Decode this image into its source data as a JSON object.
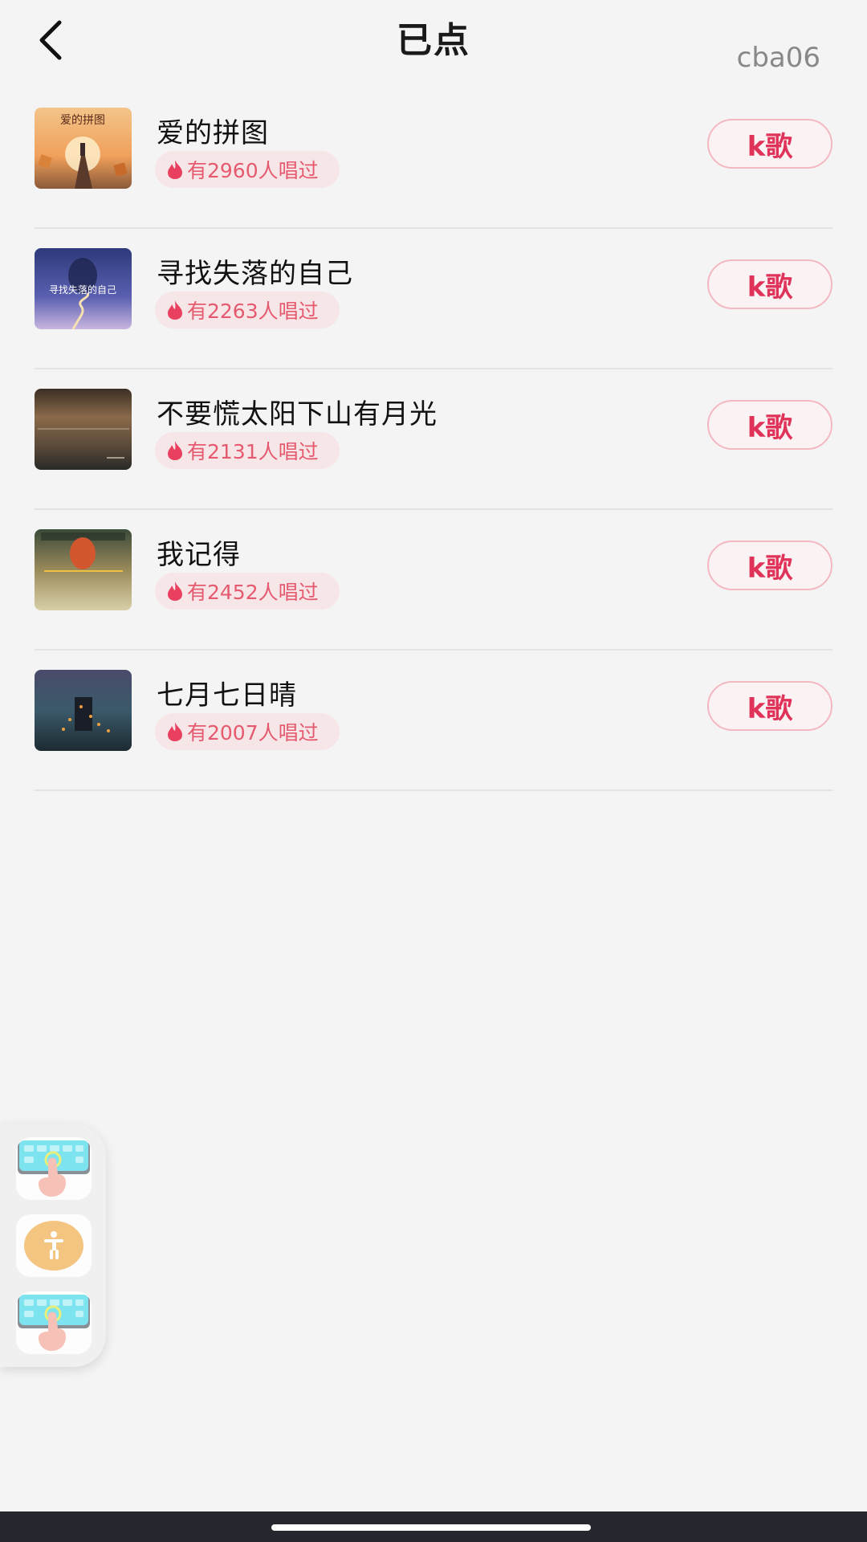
{
  "header": {
    "title": "已点",
    "user_tag": "cba06"
  },
  "songs": [
    {
      "name": "爱的拼图",
      "heat": "有2960人唱过",
      "button": "k歌"
    },
    {
      "name": "寻找失落的自己",
      "heat": "有2263人唱过",
      "button": "k歌"
    },
    {
      "name": "不要慌太阳下山有月光",
      "heat": "有2131人唱过",
      "button": "k歌"
    },
    {
      "name": "我记得",
      "heat": "有2452人唱过",
      "button": "k歌"
    },
    {
      "name": "七月七日晴",
      "heat": "有2007人唱过",
      "button": "k歌"
    }
  ],
  "float_panel": {
    "icons": [
      "keyboard-tap-icon",
      "accessibility-icon",
      "keyboard-tap-icon"
    ]
  },
  "colors": {
    "accent": "#e0335a",
    "pill_bg": "#f6e6e8",
    "background": "#f4f4f4"
  }
}
